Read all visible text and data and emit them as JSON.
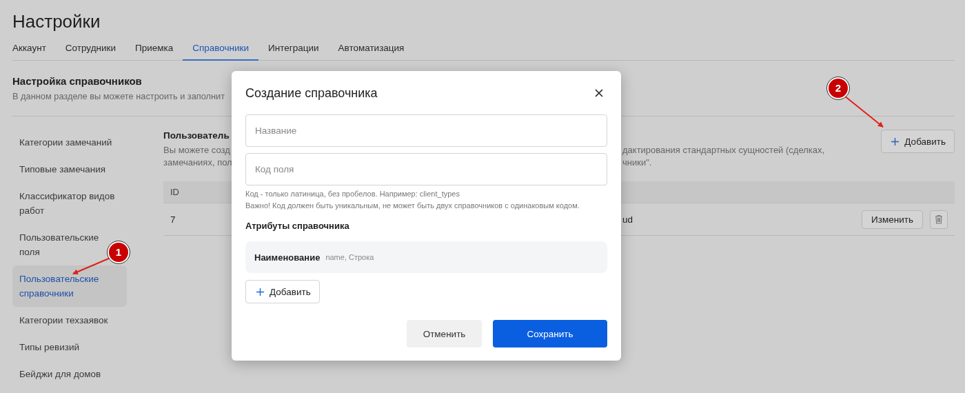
{
  "page": {
    "title": "Настройки"
  },
  "tabs": [
    {
      "label": "Аккаунт",
      "selected": false
    },
    {
      "label": "Сотрудники",
      "selected": false
    },
    {
      "label": "Приемка",
      "selected": false
    },
    {
      "label": "Справочники",
      "selected": true
    },
    {
      "label": "Интеграции",
      "selected": false
    },
    {
      "label": "Автоматизация",
      "selected": false
    }
  ],
  "section": {
    "title": "Настройка справочников",
    "description": "В данном разделе вы можете настроить и заполнит"
  },
  "sidebar": {
    "items": [
      {
        "label": "Категории замечаний",
        "selected": false
      },
      {
        "label": "Типовые замечания",
        "selected": false
      },
      {
        "label": "Классификатор видов работ",
        "selected": false
      },
      {
        "label": "Пользовательские поля",
        "selected": false
      },
      {
        "label": "Пользовательские справочники",
        "selected": true
      },
      {
        "label": "Категории техзаявок",
        "selected": false
      },
      {
        "label": "Типы ревизий",
        "selected": false
      },
      {
        "label": "Бейджи для домов",
        "selected": false
      }
    ]
  },
  "main": {
    "title": "Пользователь",
    "description_left": [
      "Вы можете созд",
      "замечаниях, пол"
    ],
    "description_right": [
      "дактирования стандартных сущностей (сделках,",
      "чники\"."
    ],
    "add_button": "Добавить"
  },
  "table": {
    "columns": [
      "ID"
    ],
    "rows": [
      {
        "column_1": "7",
        "column_2": "ud",
        "edit_button": "Изменить"
      }
    ]
  },
  "dialog": {
    "title": "Создание справочника",
    "name_field": {
      "placeholder": "Название"
    },
    "code_field": {
      "placeholder": "Код поля"
    },
    "hints": [
      "Код - только латиница, без пробелов. Например: client_types",
      "Важно! Код должен быть уникальным, не может быть двух справочников с одинаковым кодом."
    ],
    "attributes_title": "Атрибуты справочника",
    "attributes": [
      {
        "name": "Наименование",
        "details": "name, Строка"
      }
    ],
    "add_button": "Добавить",
    "cancel_button": "Отменить",
    "save_button": "Сохранить"
  },
  "annotations": [
    {
      "number": "1"
    },
    {
      "number": "2"
    }
  ]
}
